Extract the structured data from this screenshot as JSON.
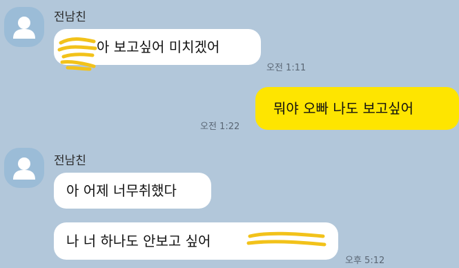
{
  "chat": {
    "messages": [
      {
        "sender": "전남친",
        "text": "아 보고싶어 미치겠어",
        "time": "오전 1:11"
      },
      {
        "text": "뭐야 오빠 나도 보고싶어",
        "time": "오전 1:22"
      },
      {
        "sender": "전남친",
        "text": "아 어제 너무취했다"
      },
      {
        "text": "나 너 하나도 안보고 싶어",
        "time": "오후 5:12"
      }
    ]
  },
  "colors": {
    "background": "#b2c7da",
    "incoming_bubble": "#ffffff",
    "outgoing_bubble": "#fee500",
    "redaction_marker": "#f2c21a"
  },
  "icons": {
    "avatar": "default-profile-icon"
  }
}
